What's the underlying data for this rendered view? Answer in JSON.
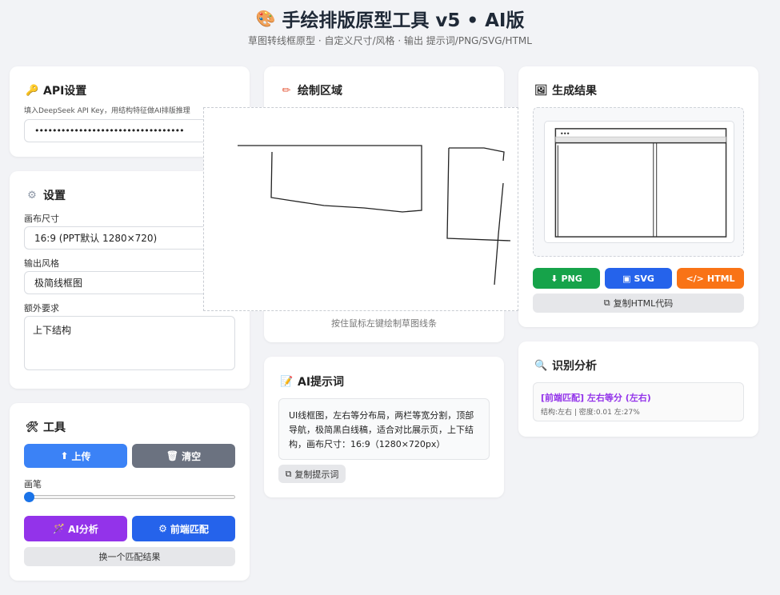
{
  "header": {
    "title": "手绘排版原型工具 v5 • AI版",
    "subtitle": "草图转线框原型 · 自定义尺寸/风格 · 输出 提示词/PNG/SVG/HTML"
  },
  "api": {
    "title": "API设置",
    "hint": "填入DeepSeek API Key，用结构特征做AI排版推理",
    "key_value": "••••••••••••••••••••••••••••••••••"
  },
  "settings": {
    "title": "设置",
    "canvas_label": "画布尺寸",
    "canvas_value": "16:9 (PPT默认 1280×720)",
    "style_label": "输出风格",
    "style_value": "极简线框图",
    "extra_label": "额外要求",
    "extra_value": "上下结构"
  },
  "tools": {
    "title": "工具",
    "upload": "上传",
    "clear": "清空",
    "brush_label": "画笔",
    "brush_level": 0.0,
    "ai_analyze": "AI分析",
    "front_match": "前端匹配",
    "next_match": "换一个匹配结果"
  },
  "draw": {
    "title": "绘制区域",
    "hint": "按住鼠标左键绘制草图线条"
  },
  "prompt": {
    "title": "AI提示词",
    "text": "UI线框图，左右等分布局，两栏等宽分割，顶部导航，极简黑白线稿，适合对比展示页，上下结构，画布尺寸：16:9（1280×720px）",
    "copy": "复制提示词"
  },
  "result": {
    "title": "生成结果",
    "png": "PNG",
    "svg": "SVG",
    "html": "HTML",
    "copy_html": "复制HTML代码"
  },
  "analysis": {
    "title": "识别分析",
    "tag": "[前端匹配]",
    "match": "左右等分 (左右)",
    "detail": "结构:左右 | 密度:0.01 左:27%"
  },
  "colors": {
    "blue": "#3b82f6",
    "gray": "#6b7280",
    "purple": "#9333ea",
    "royal": "#2563eb",
    "green": "#16a34a",
    "orange": "#f97316"
  }
}
